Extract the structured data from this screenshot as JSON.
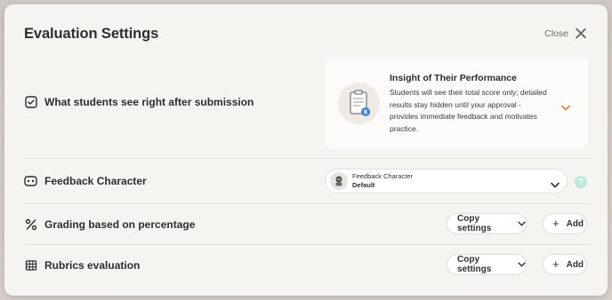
{
  "modal": {
    "title": "Evaluation Settings",
    "close_label": "Close"
  },
  "rows": {
    "after_submission": {
      "label": "What students see right after submission",
      "option": {
        "title": "Insight of Their Performance",
        "description": "Students will see their total score only; detailed results stay hidden until your approval - provides immediate feedback and motivates practice.",
        "badge": "8"
      }
    },
    "feedback_character": {
      "label": "Feedback Character",
      "select_title": "Feedback Character",
      "select_value": "Default",
      "help": "?"
    },
    "grading_percentage": {
      "label": "Grading based on percentage",
      "copy_label": "Copy settings",
      "add_label": "Add"
    },
    "rubrics": {
      "label": "Rubrics evaluation",
      "copy_label": "Copy settings",
      "add_label": "Add"
    }
  },
  "colors": {
    "accent": "#e07b39",
    "help": "#b9ead7",
    "badge": "#3b82d6"
  }
}
